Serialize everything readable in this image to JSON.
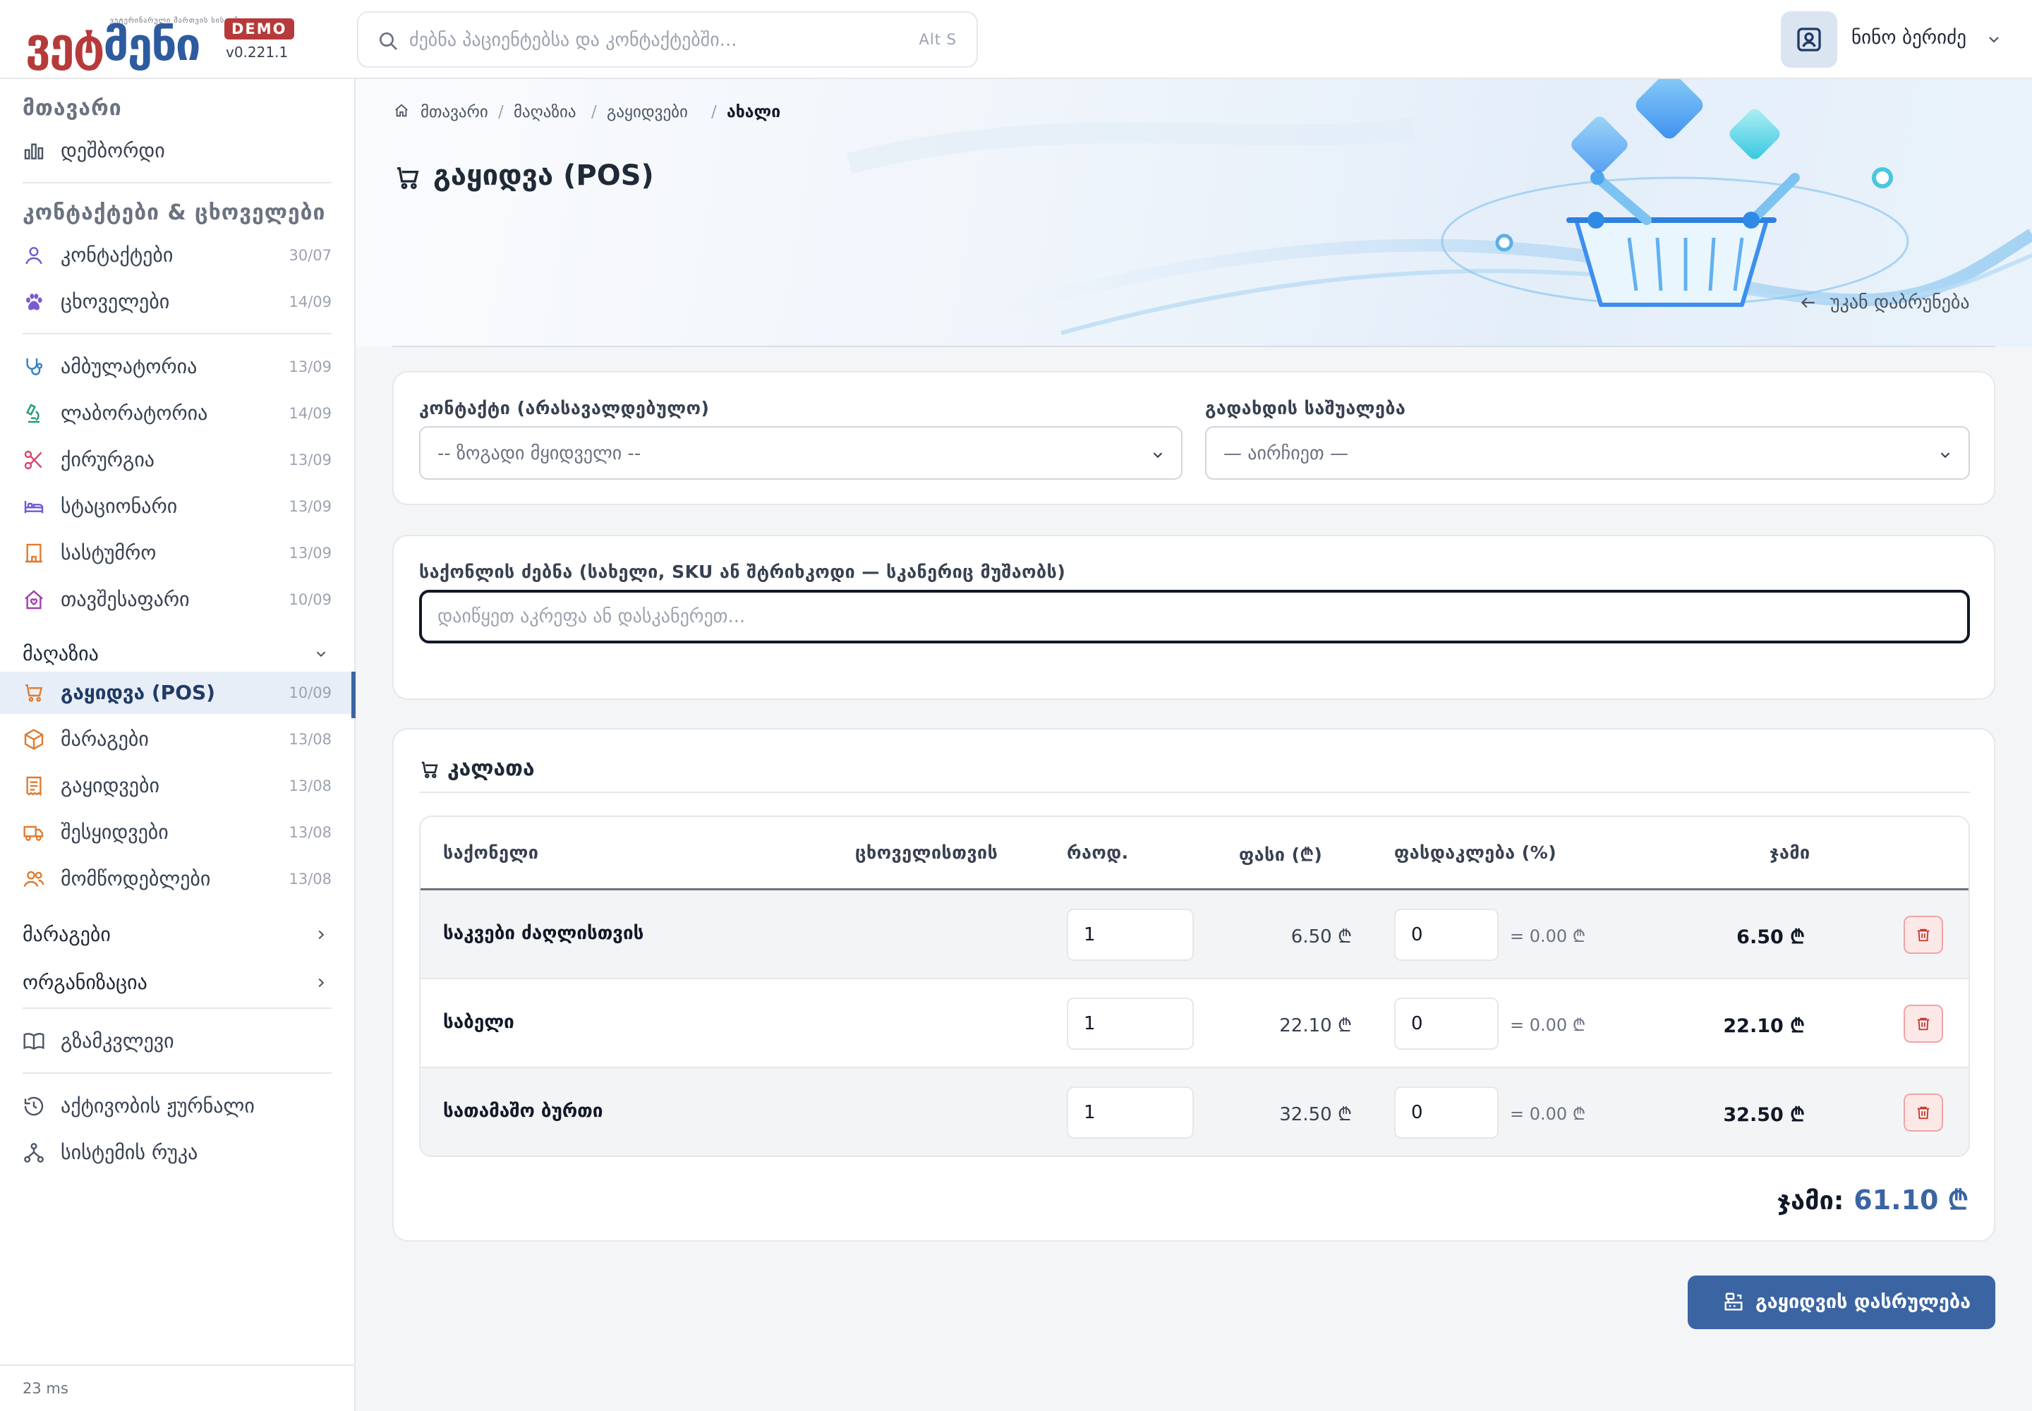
{
  "app": {
    "logo_text_a": "ვეტ",
    "logo_text_b": "მენი",
    "logo_tagline": "ვეტერინარული მართვის სისტემა",
    "badge": "DEMO",
    "version": "v0.221.1"
  },
  "search": {
    "placeholder": "ძებნა პაციენტებსა და კონტაქტებში...",
    "shortcut": "Alt S"
  },
  "user": {
    "name": "ნინო ბერიძე"
  },
  "sidebar": {
    "main_title": "მთავარი",
    "dashboard": "დეშბორდი",
    "contacts_title": "კონტაქტები & ცხოველები",
    "items": [
      {
        "label": "კონტაქტები",
        "date": "30/07",
        "icon": "user-icon"
      },
      {
        "label": "ცხოველები",
        "date": "14/09",
        "icon": "paw-icon"
      },
      {
        "label": "ამბულატორია",
        "date": "13/09",
        "icon": "stethoscope-icon"
      },
      {
        "label": "ლაბორატორია",
        "date": "14/09",
        "icon": "microscope-icon"
      },
      {
        "label": "ქირურგია",
        "date": "13/09",
        "icon": "scissors-icon"
      },
      {
        "label": "სტაციონარი",
        "date": "13/09",
        "icon": "bed-icon"
      },
      {
        "label": "სასტუმრო",
        "date": "13/09",
        "icon": "hotel-icon"
      },
      {
        "label": "თავშესაფარი",
        "date": "10/09",
        "icon": "shelter-icon"
      }
    ],
    "shop_group": "მაღაზია",
    "shop_items": [
      {
        "label": "გაყიდვა (POS)",
        "date": "10/09",
        "icon": "cart-icon"
      },
      {
        "label": "მარაგები",
        "date": "13/08",
        "icon": "box-icon"
      },
      {
        "label": "გაყიდვები",
        "date": "13/08",
        "icon": "receipt-icon"
      },
      {
        "label": "შესყიდვები",
        "date": "13/08",
        "icon": "truck-icon"
      },
      {
        "label": "მომწოდებლები",
        "date": "13/08",
        "icon": "users-icon"
      }
    ],
    "stocks_group": "მარაგები",
    "org_group": "ორგანიზაცია",
    "guide": "გზამკვლევი",
    "activity": "აქტივობის ჟურნალი",
    "sitemap": "სისტემის რუკა",
    "footer": "23 ms"
  },
  "breadcrumb": [
    "მთავარი",
    "მაღაზია",
    "გაყიდვები",
    "ახალი"
  ],
  "page": {
    "title": "გაყიდვა (POS)",
    "back": "უკან დაბრუნება"
  },
  "form": {
    "contact_label": "კონტაქტი (არასავალდებულო)",
    "contact_value": "-- ზოგადი მყიდველი --",
    "payment_label": "გადახდის საშუალება",
    "payment_value": "— აირჩიეთ —",
    "search_label": "საქონლის ძებნა (სახელი, SKU ან შტრიხკოდი — სკანერიც მუშაობს)",
    "search_placeholder": "დაიწყეთ აკრეფა ან დასკანერეთ..."
  },
  "cart": {
    "title": "კალათა",
    "headers": {
      "product": "საქონელი",
      "for_animal": "ცხოველისთვის",
      "qty": "რაოდ.",
      "price": "ფასი (₾)",
      "discount": "ფასდაკლება (%)",
      "sum": "ჯამი"
    },
    "rows": [
      {
        "name": "საკვები ძაღლისთვის",
        "qty": "1",
        "price": "6.50 ₾",
        "discount": "0",
        "discount_amount": "= 0.00 ₾",
        "sum": "6.50 ₾"
      },
      {
        "name": "საბელი",
        "qty": "1",
        "price": "22.10 ₾",
        "discount": "0",
        "discount_amount": "= 0.00 ₾",
        "sum": "22.10 ₾"
      },
      {
        "name": "სათამაშო ბურთი",
        "qty": "1",
        "price": "32.50 ₾",
        "discount": "0",
        "discount_amount": "= 0.00 ₾",
        "sum": "32.50 ₾"
      }
    ],
    "total_label": "ჯამი:",
    "total_value": "61.10 ₾"
  },
  "actions": {
    "finish": "გაყიდვის დასრულება"
  },
  "colors": {
    "accent": "#3b64a3",
    "brand_red": "#b73a3a",
    "danger": "#dc3545"
  }
}
